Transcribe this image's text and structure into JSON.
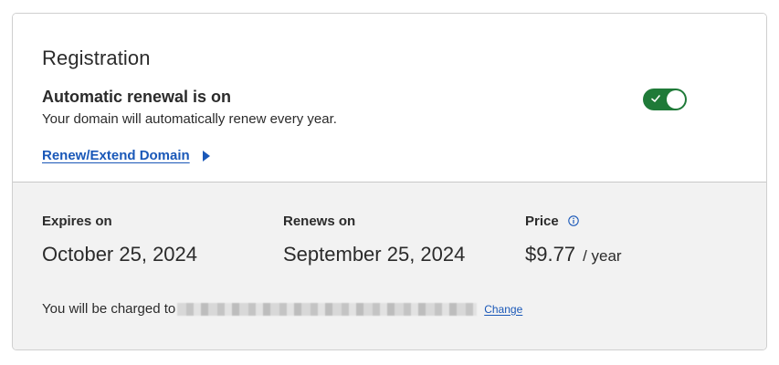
{
  "registration": {
    "title": "Registration",
    "auto_renew_status": "Automatic renewal is on",
    "auto_renew_description": "Your domain will automatically renew every year.",
    "auto_renew_enabled": true,
    "renew_link_label": "Renew/Extend Domain"
  },
  "details": {
    "expires_label": "Expires on",
    "expires_value": "October 25, 2024",
    "renews_label": "Renews on",
    "renews_value": "September 25, 2024",
    "price_label": "Price",
    "price_value": "$9.77",
    "price_unit": "/ year"
  },
  "billing": {
    "charged_to_label": "You will be charged to",
    "change_label": "Change"
  },
  "colors": {
    "link": "#1a58b8",
    "toggle_on": "#1f7a38",
    "panel_background": "#f2f2f2"
  },
  "icons": {
    "toggle_check": "check-icon",
    "link_caret": "caret-right-icon",
    "price_info": "info-icon"
  }
}
